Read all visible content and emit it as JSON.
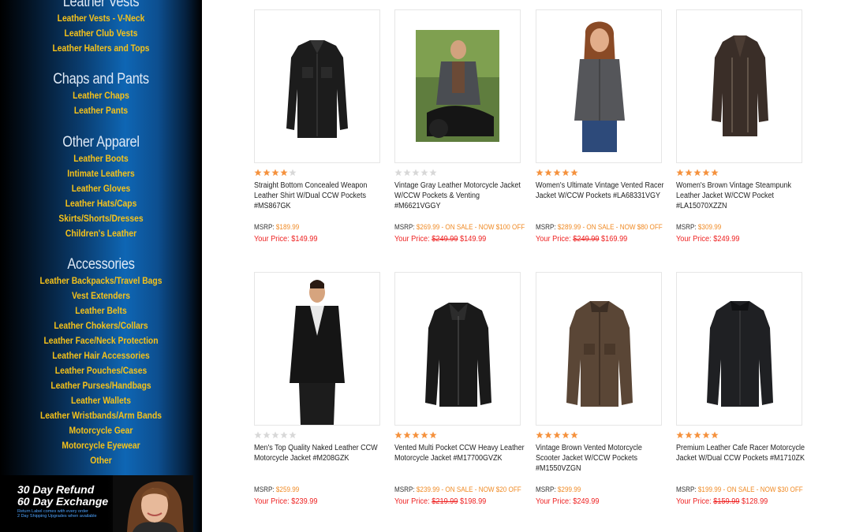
{
  "sidebar": {
    "sections": [
      {
        "heading": "Leather Vests",
        "links": [
          "Leather Vests - V-Neck",
          "Leather Club Vests",
          "Leather Halters and Tops"
        ]
      },
      {
        "heading": "Chaps and Pants",
        "links": [
          "Leather Chaps",
          "Leather Pants"
        ]
      },
      {
        "heading": "Other Apparel",
        "links": [
          "Leather Boots",
          "Intimate Leathers",
          "Leather Gloves",
          "Leather Hats/Caps",
          "Skirts/Shorts/Dresses",
          "Children's Leather"
        ]
      },
      {
        "heading": "Accessories",
        "links": [
          "Leather Backpacks/Travel Bags",
          "Vest Extenders",
          "Leather Belts",
          "Leather Chokers/Collars",
          "Leather Face/Neck Protection",
          "Leather Hair Accessories",
          "Leather Pouches/Cases",
          "Leather Purses/Handbags",
          "Leather Wallets",
          "Leather Wristbands/Arm Bands",
          "Motorcycle Gear",
          "Motorcycle Eyewear",
          "Other"
        ]
      }
    ],
    "promo": {
      "line1": "30 Day Refund",
      "line2": "60 Day Exchange",
      "line3": "Return Label comes with every order",
      "line4": "2 Day Shipping Upgrades when available"
    }
  },
  "products": [
    {
      "name": "Straight Bottom Concealed Weapon Leather Shirt W/Dual CCW Pockets #MS867GK",
      "rating": 4,
      "msrp_label": "MSRP:",
      "msrp": "$189.99",
      "sale_note": "",
      "price_label": "Your Price:",
      "old_price": "",
      "price": "$149.99",
      "image": "leather-shirt-jacket"
    },
    {
      "name": "Vintage Gray Leather Motorcycle Jacket W/CCW Pockets & Venting #M6621VGGY",
      "rating": 0,
      "msrp_label": "MSRP:",
      "msrp": "$269.99",
      "sale_note": " - ON SALE - NOW $100 OFF",
      "price_label": "Your Price:",
      "old_price": "$249.99",
      "price": "$149.99",
      "image": "man-on-motorcycle-photo"
    },
    {
      "name": "Women's Ultimate Vintage Vented Racer Jacket W/CCW Pockets #LA68331VGY",
      "rating": 5,
      "msrp_label": "MSRP:",
      "msrp": "$289.99",
      "sale_note": " - ON SALE - NOW $80 OFF",
      "price_label": "Your Price:",
      "old_price": "$249.99",
      "price": "$169.99",
      "image": "woman-in-gray-jacket"
    },
    {
      "name": "Women's Brown Vintage Steampunk Leather Jacket W/CCW Pocket #LA15070XZZN",
      "rating": 5,
      "msrp_label": "MSRP:",
      "msrp": "$309.99",
      "sale_note": "",
      "price_label": "Your Price:",
      "old_price": "",
      "price": "$249.99",
      "image": "brown-steampunk-jacket"
    },
    {
      "name": "Men's Top Quality Naked Leather CCW Motorcycle Jacket #M208GZK",
      "rating": 0,
      "msrp_label": "MSRP:",
      "msrp": "$259.99",
      "sale_note": "",
      "price_label": "Your Price:",
      "old_price": "",
      "price": "$239.99",
      "image": "man-in-biker-jacket"
    },
    {
      "name": "Vented Multi Pocket CCW Heavy Leather Motorcycle Jacket #M17700GVZK",
      "rating": 5,
      "msrp_label": "MSRP:",
      "msrp": "$239.99",
      "sale_note": " - ON SALE - NOW $20 OFF",
      "price_label": "Your Price:",
      "old_price": "$219.99",
      "price": "$198.99",
      "image": "black-biker-jacket"
    },
    {
      "name": "Vintage Brown Vented Motorcycle Scooter Jacket W/CCW Pockets #M1550VZGN",
      "rating": 5,
      "msrp_label": "MSRP:",
      "msrp": "$299.99",
      "sale_note": "",
      "price_label": "Your Price:",
      "old_price": "",
      "price": "$249.99",
      "image": "brown-scooter-jacket"
    },
    {
      "name": "Premium Leather Cafe Racer Motorcycle Jacket W/Dual CCW Pockets #M1710ZK",
      "rating": 5,
      "msrp_label": "MSRP:",
      "msrp": "$199.99",
      "sale_note": " - ON SALE - NOW $30 OFF",
      "price_label": "Your Price:",
      "old_price": "$159.99",
      "price": "$128.99",
      "image": "cafe-racer-jacket"
    }
  ],
  "colors": {
    "sidebar_link": "#f6c21a",
    "star_filled": "#f5923e",
    "star_empty": "#d8d8d8",
    "price_red": "#e22222",
    "msrp_orange": "#f08a24"
  }
}
